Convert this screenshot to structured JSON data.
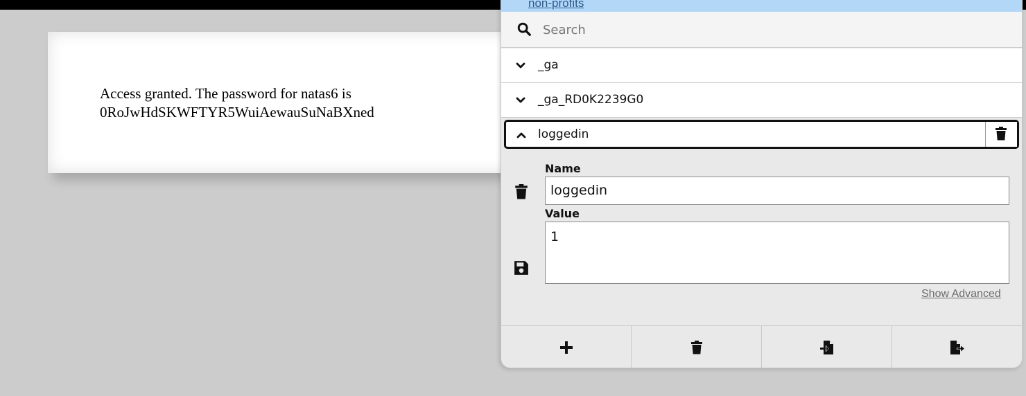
{
  "page": {
    "message": "Access granted. The password for natas6 is 0RoJwHdSKWFTYR5WuiAewauSuNaBXned"
  },
  "popup": {
    "link_text": "non-profits",
    "search": {
      "placeholder": "Search",
      "icon": "search-icon"
    },
    "cookies": [
      {
        "name": "_ga",
        "expanded": false
      },
      {
        "name": "_ga_RD0K2239G0",
        "expanded": false
      },
      {
        "name": "loggedin",
        "expanded": true
      }
    ],
    "editor": {
      "name_label": "Name",
      "name_value": "loggedin",
      "value_label": "Value",
      "value_value": "1",
      "advanced_link": "Show Advanced"
    },
    "footer": [
      "add-icon",
      "trash-icon",
      "import-icon",
      "export-icon"
    ]
  },
  "colors": {
    "page_bg": "#cccccc",
    "link_strip": "#b3d7f7",
    "popup_bg": "#e9e9e9"
  }
}
